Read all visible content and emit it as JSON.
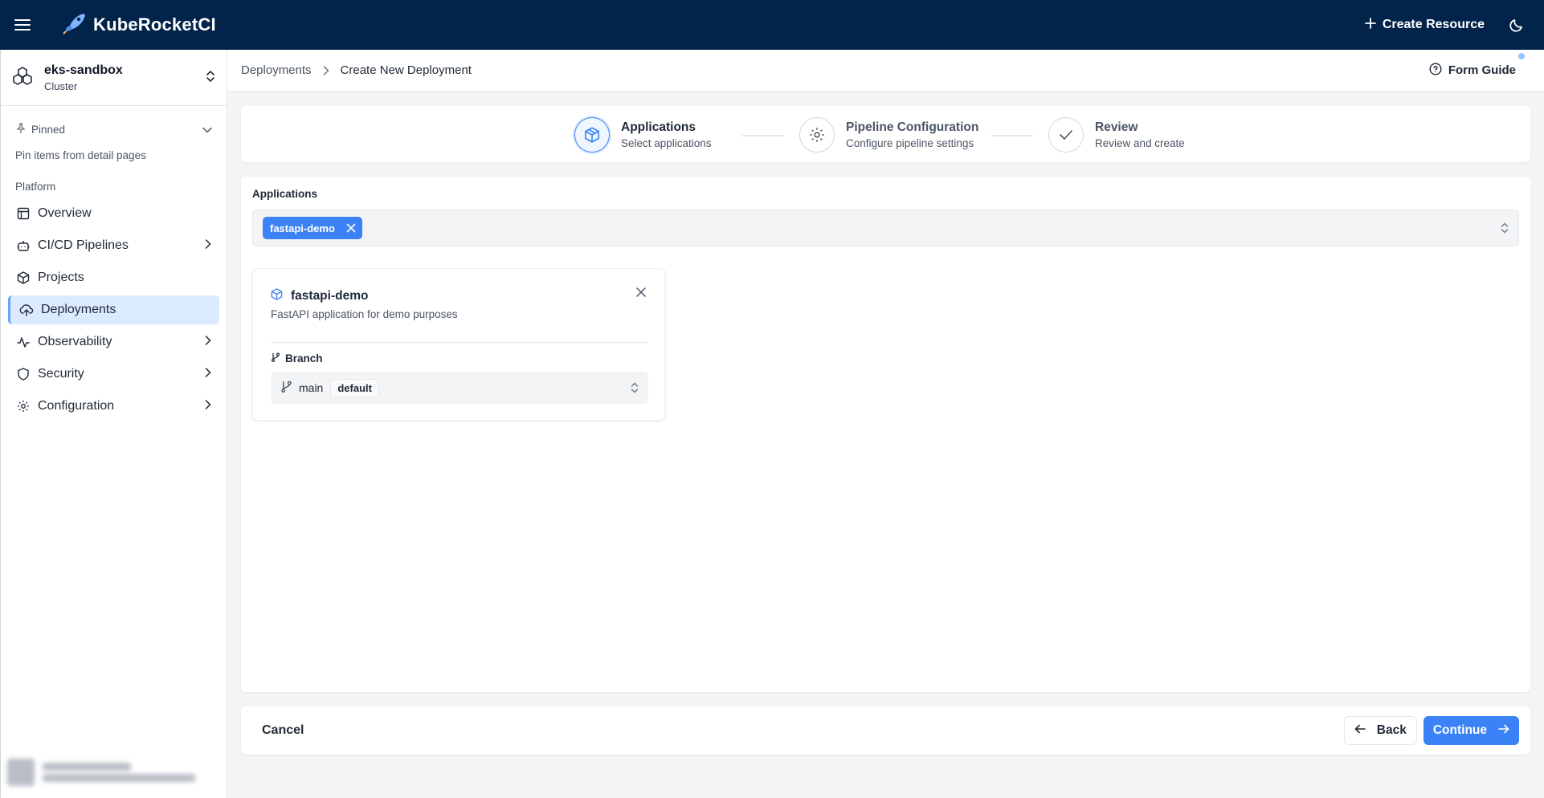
{
  "app": {
    "name": "KubeRocketCI",
    "create_resource": "Create Resource"
  },
  "cluster": {
    "name": "eks-sandbox",
    "type": "Cluster"
  },
  "sidebar": {
    "pinned_label": "Pinned",
    "pinned_hint": "Pin items from detail pages",
    "section_label": "Platform",
    "items": [
      {
        "label": "Overview",
        "icon": "layout-icon"
      },
      {
        "label": "CI/CD Pipelines",
        "icon": "bot-icon"
      },
      {
        "label": "Projects",
        "icon": "package-icon"
      },
      {
        "label": "Deployments",
        "icon": "cloud-upload-icon"
      },
      {
        "label": "Observability",
        "icon": "activity-icon"
      },
      {
        "label": "Security",
        "icon": "shield-icon"
      },
      {
        "label": "Configuration",
        "icon": "gear-icon"
      }
    ]
  },
  "breadcrumb": {
    "parent": "Deployments",
    "current": "Create New Deployment"
  },
  "form_guide": "Form Guide",
  "stepper": {
    "steps": [
      {
        "title": "Applications",
        "subtitle": "Select applications",
        "active": true
      },
      {
        "title": "Pipeline Configuration",
        "subtitle": "Configure pipeline settings",
        "active": false
      },
      {
        "title": "Review",
        "subtitle": "Review and create",
        "active": false
      }
    ]
  },
  "applications": {
    "label": "Applications",
    "selected_chips": [
      "fastapi-demo"
    ],
    "cards": [
      {
        "name": "fastapi-demo",
        "description": "FastAPI application for demo purposes",
        "branch_label": "Branch",
        "branch_value": "main",
        "branch_badge": "default"
      }
    ]
  },
  "footer": {
    "cancel": "Cancel",
    "back": "Back",
    "continue": "Continue"
  },
  "colors": {
    "topbar": "#02234a",
    "accent": "#3b82f6",
    "active_nav": "#dbeafe"
  }
}
